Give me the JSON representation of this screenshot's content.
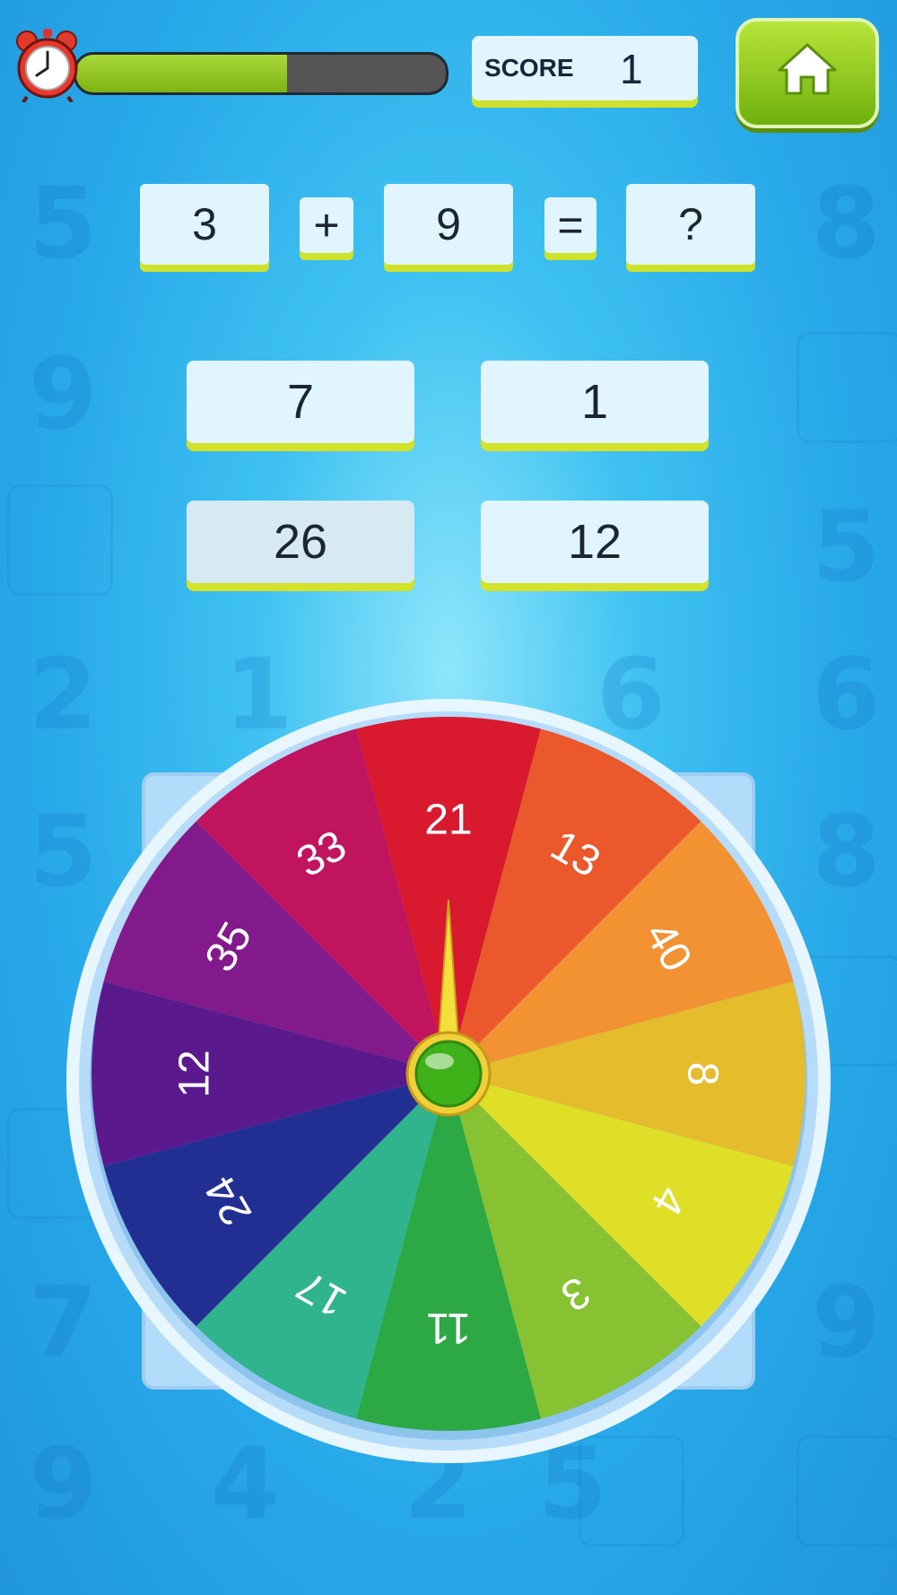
{
  "hud": {
    "timer_progress": 0.57,
    "score_label": "SCORE",
    "score_value": "1",
    "home_icon": "home-icon"
  },
  "equation": {
    "operand1": "3",
    "operator": "+",
    "operand2": "9",
    "equals": "=",
    "result": "?"
  },
  "answers": [
    "7",
    "1",
    "26",
    "12"
  ],
  "wheel": {
    "segments": [
      {
        "label": "21",
        "color": "#d8192e"
      },
      {
        "label": "13",
        "color": "#ea582b"
      },
      {
        "label": "40",
        "color": "#f29232"
      },
      {
        "label": "8",
        "color": "#e4bc2c"
      },
      {
        "label": "4",
        "color": "#dfdf28"
      },
      {
        "label": "3",
        "color": "#86c232"
      },
      {
        "label": "11",
        "color": "#2ca844"
      },
      {
        "label": "17",
        "color": "#2fb48e"
      },
      {
        "label": "24",
        "color": "#222f92"
      },
      {
        "label": "12",
        "color": "#5a1a8e"
      },
      {
        "label": "35",
        "color": "#821a8c"
      },
      {
        "label": "33",
        "color": "#c0145e"
      }
    ],
    "hub_color": "#3fb21a",
    "pointer_color": "#f3e03a"
  },
  "background_digits": [
    "5",
    "9",
    "8",
    "2",
    "1",
    "6",
    "6",
    "5",
    "8",
    "5",
    "7",
    "9",
    "9",
    "4",
    "2",
    "5"
  ]
}
